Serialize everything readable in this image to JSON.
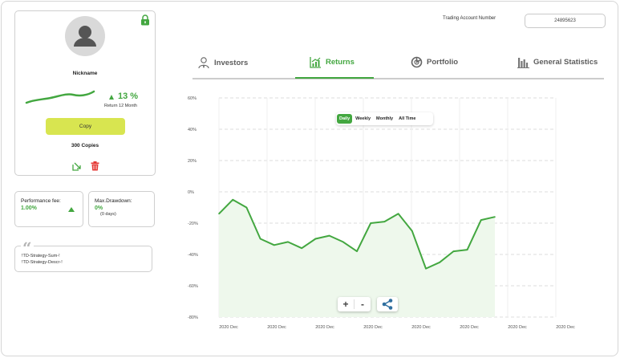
{
  "profile": {
    "nickname": "Nickname",
    "return_value": "13 %",
    "return_label": "Return 12 Month",
    "copy_label": "Copy",
    "copies": "300 Copies"
  },
  "stats": {
    "performance_fee_label": "Performance fee:",
    "performance_fee_value": "1.00%",
    "max_drawdown_label": "Max.Drawdown:",
    "max_drawdown_value": "0%",
    "max_drawdown_sub": "(0 days)"
  },
  "description": {
    "line1": "!TD-Strategy-Sum-!",
    "line2": "!TD-Strategy-Descr-!"
  },
  "header": {
    "account_label": "Trading Account Number",
    "account_number": "24895623"
  },
  "tabs": [
    {
      "label": "Investors",
      "icon": "investor-icon"
    },
    {
      "label": "Returns",
      "icon": "returns-chart-icon"
    },
    {
      "label": "Portfolio",
      "icon": "portfolio-icon"
    },
    {
      "label": "General Statistics",
      "icon": "statistics-icon"
    }
  ],
  "active_tab": "Returns",
  "range_buttons": [
    "Daily",
    "Weekly",
    "Monthly",
    "All Time"
  ],
  "active_range": "Daily",
  "zoom": {
    "plus": "+",
    "minus": "-"
  },
  "colors": {
    "accent": "#43a740",
    "copy_button": "#d8e550",
    "delete": "#e53935",
    "share": "#2f6f9f"
  },
  "chart_data": {
    "type": "area",
    "ylim": [
      -80,
      60
    ],
    "y_ticks": [
      "60%",
      "40%",
      "20%",
      "0%",
      "-20%",
      "-40%",
      "-60%",
      "-80%"
    ],
    "y_tick_values": [
      60,
      40,
      20,
      0,
      -20,
      -40,
      -60,
      -80
    ],
    "x_ticks": [
      "2020 Dec",
      "2020 Dec",
      "2020 Dec",
      "2020 Dec",
      "2020 Dec",
      "2020 Dec",
      "2020 Dec",
      "2020 Dec"
    ],
    "grid": true,
    "series": [
      {
        "values": [
          -14,
          -5,
          -10,
          -30,
          -34,
          -32,
          -36,
          -30,
          -28,
          -32,
          -38,
          -20,
          -19,
          -14,
          -25,
          -49,
          -45,
          -38,
          -37,
          -18,
          -16
        ]
      }
    ]
  }
}
